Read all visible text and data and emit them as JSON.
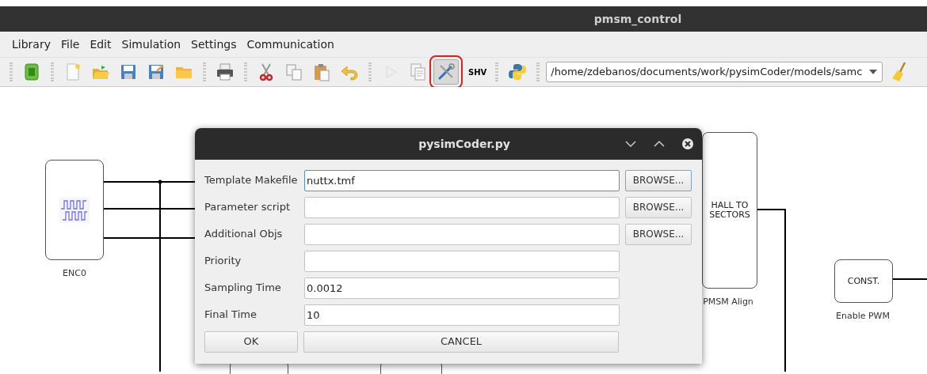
{
  "window": {
    "title": "pmsm_control"
  },
  "menu": [
    {
      "label": "Library"
    },
    {
      "label": "File"
    },
    {
      "label": "Edit"
    },
    {
      "label": "Simulation"
    },
    {
      "label": "Settings"
    },
    {
      "label": "Communication"
    }
  ],
  "toolbar": {
    "groups": [
      [
        {
          "kind": "calculator",
          "disabled": false,
          "highlighted": false
        }
      ],
      [
        {
          "kind": "new",
          "disabled": false,
          "highlighted": false
        },
        {
          "kind": "open",
          "disabled": false,
          "highlighted": false
        },
        {
          "kind": "save",
          "disabled": false,
          "highlighted": false
        },
        {
          "kind": "save-as",
          "disabled": false,
          "highlighted": false
        },
        {
          "kind": "folder",
          "disabled": false,
          "highlighted": false
        }
      ],
      [
        {
          "kind": "print",
          "disabled": false,
          "highlighted": false
        }
      ],
      [
        {
          "kind": "cut",
          "disabled": false,
          "highlighted": false
        },
        {
          "kind": "copy",
          "disabled": false,
          "highlighted": false
        },
        {
          "kind": "paste",
          "disabled": false,
          "highlighted": false
        },
        {
          "kind": "undo",
          "disabled": false,
          "highlighted": false
        }
      ],
      [
        {
          "kind": "run",
          "disabled": true,
          "highlighted": false
        },
        {
          "kind": "documents",
          "disabled": false,
          "highlighted": false
        },
        {
          "kind": "tools",
          "disabled": false,
          "highlighted": true
        },
        {
          "kind": "text",
          "label": "SHV",
          "disabled": false,
          "highlighted": false
        }
      ],
      [
        {
          "kind": "python",
          "disabled": false,
          "highlighted": false
        }
      ]
    ],
    "path": "/home/zdebanos/documents/work/pysimCoder/models/samc"
  },
  "canvas": {
    "blocks": [
      {
        "kind": "encoder",
        "caption": "ENC0"
      },
      {
        "kind": "text",
        "label": "HALL TO SECTORS",
        "caption": "PMSM Align"
      },
      {
        "kind": "text",
        "label": "CONST.",
        "caption": "Enable PWM"
      },
      {
        "kind": "plain"
      },
      {
        "kind": "plain"
      }
    ]
  },
  "dialog": {
    "title": "pysimCoder.py",
    "fields": [
      {
        "label": "Template Makefile",
        "value": "nuttx.tmf",
        "focused": true,
        "browse": "BROWSE..."
      },
      {
        "label": "Parameter script",
        "focused": false,
        "browse": "BROWSE..."
      },
      {
        "label": "Additional Objs",
        "focused": false,
        "browse": "BROWSE..."
      },
      {
        "label": "Priority",
        "focused": false
      },
      {
        "label": "Sampling Time",
        "value": "0.0012",
        "focused": false
      },
      {
        "label": "Final Time",
        "value": "10",
        "focused": false
      }
    ],
    "buttons": [
      "OK",
      "CANCEL"
    ]
  }
}
